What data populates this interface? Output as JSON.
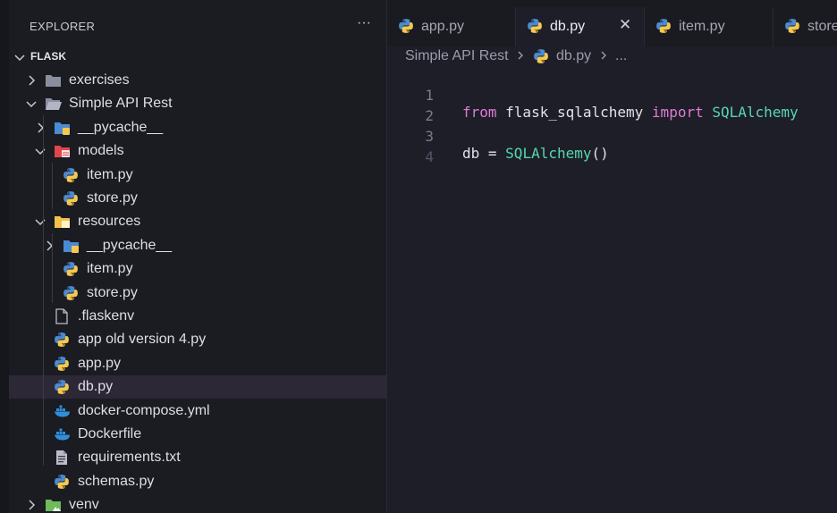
{
  "explorer": {
    "title": "EXPLORER",
    "more": "···"
  },
  "folder": {
    "name": "FLASK"
  },
  "tree": [
    {
      "label": "exercises",
      "kind": "folder",
      "expanded": false
    },
    {
      "label": "Simple API Rest",
      "kind": "folder-open",
      "expanded": true
    },
    {
      "label": "__pycache__",
      "kind": "folder-pycache",
      "expanded": false
    },
    {
      "label": "models",
      "kind": "folder-models",
      "expanded": true
    },
    {
      "label": "item.py",
      "kind": "python"
    },
    {
      "label": "store.py",
      "kind": "python"
    },
    {
      "label": "resources",
      "kind": "folder-resources",
      "expanded": true
    },
    {
      "label": "__pycache__",
      "kind": "folder-pycache",
      "expanded": false
    },
    {
      "label": "item.py",
      "kind": "python"
    },
    {
      "label": "store.py",
      "kind": "python"
    },
    {
      "label": ".flaskenv",
      "kind": "file"
    },
    {
      "label": "app old version 4.py",
      "kind": "python"
    },
    {
      "label": "app.py",
      "kind": "python"
    },
    {
      "label": "db.py",
      "kind": "python",
      "selected": true
    },
    {
      "label": "docker-compose.yml",
      "kind": "docker"
    },
    {
      "label": "Dockerfile",
      "kind": "docker"
    },
    {
      "label": "requirements.txt",
      "kind": "text"
    },
    {
      "label": "schemas.py",
      "kind": "python"
    },
    {
      "label": "venv",
      "kind": "folder-venv",
      "expanded": false
    }
  ],
  "tabs": [
    {
      "label": "app.py",
      "active": false
    },
    {
      "label": "db.py",
      "active": true,
      "close": "✕"
    },
    {
      "label": "item.py",
      "active": false
    },
    {
      "label": "store.py",
      "active": false
    }
  ],
  "breadcrumb": {
    "folder": "Simple API Rest",
    "file": "db.py",
    "more": "..."
  },
  "code": {
    "numbers": [
      "1",
      "2",
      "3",
      "4"
    ],
    "line1": {
      "kw1": "from",
      "mod": " flask_sqlalchemy ",
      "kw2": "import",
      "cls": " SQLAlchemy"
    },
    "line3": {
      "var": "db = ",
      "cls": "SQLAlchemy",
      "call": "()"
    }
  },
  "colors": {
    "python_blue": "#4b8bd1",
    "python_yellow": "#f5c94e",
    "keyword": "#e07ad6",
    "class": "#56d8b0",
    "docker": "#2f8fdb",
    "models_red": "#e0474a",
    "resources_yellow": "#f0c24b",
    "venv_green": "#6dbb5a"
  }
}
